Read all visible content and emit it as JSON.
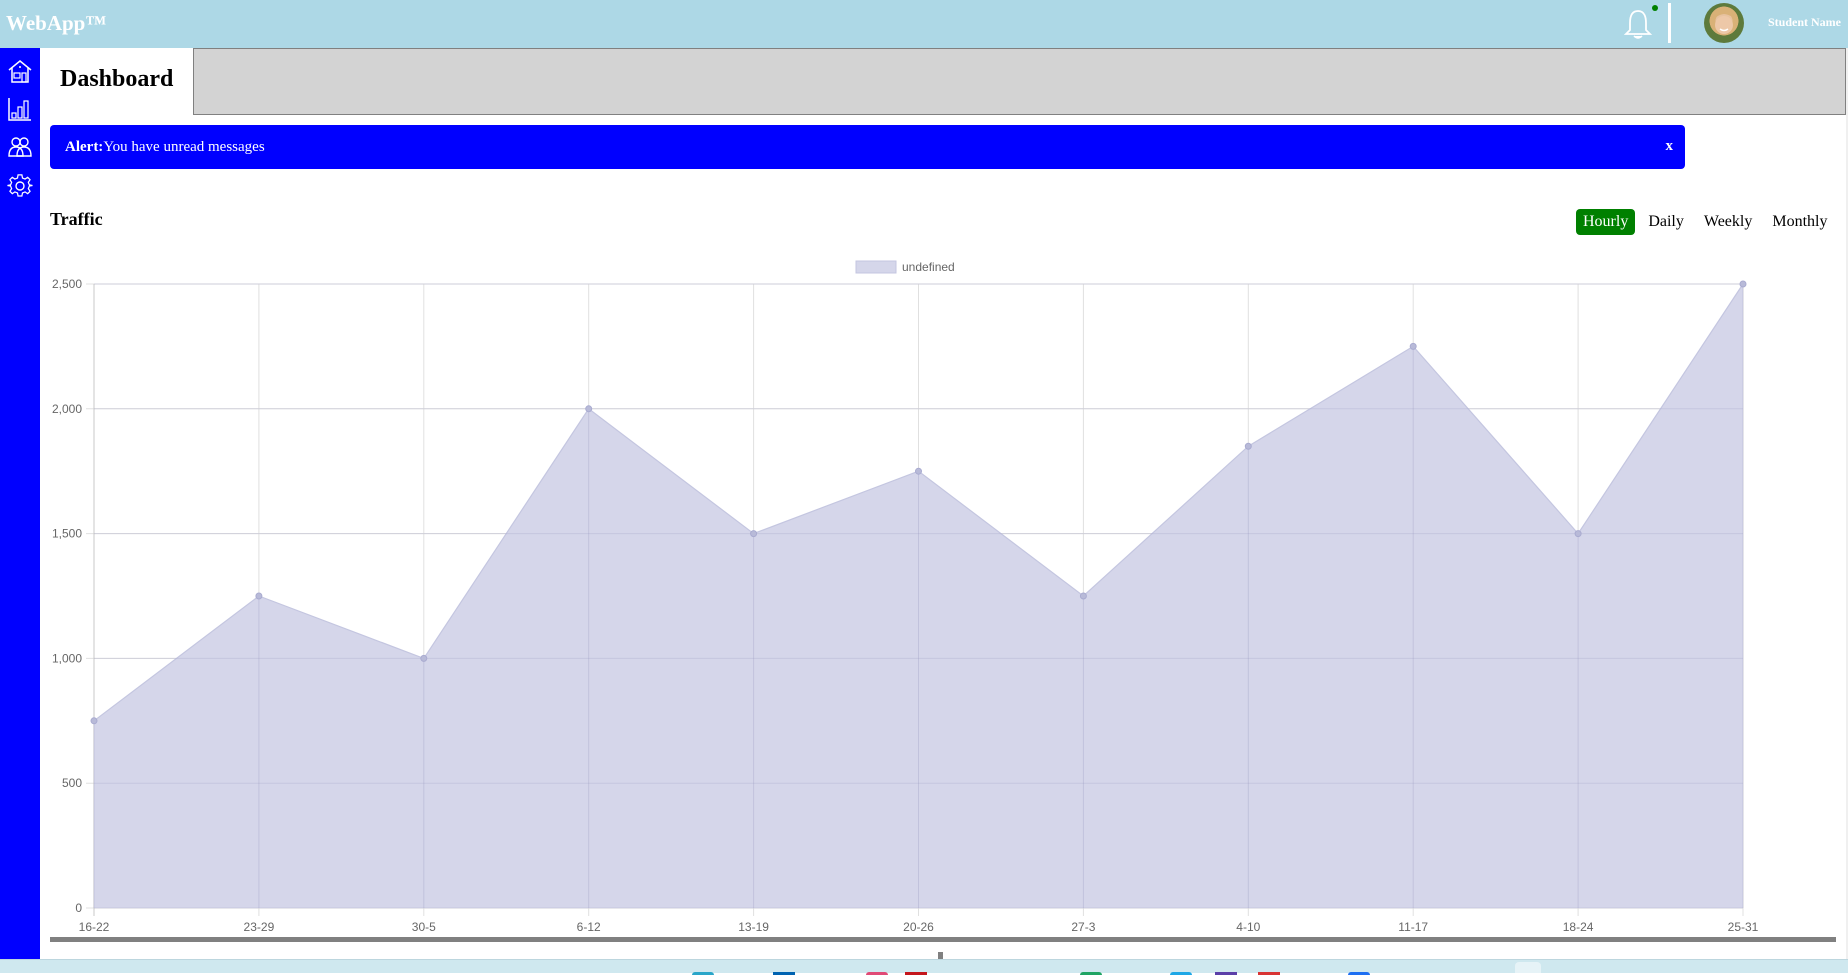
{
  "header": {
    "logo": "WebApp™",
    "user_name": "Student Name",
    "notification_dot_color": "#008000",
    "avatar_alt": "user-avatar"
  },
  "sidebar": {
    "items": [
      {
        "name": "home",
        "icon": "home-icon"
      },
      {
        "name": "analytics",
        "icon": "bar-chart-icon"
      },
      {
        "name": "users",
        "icon": "users-icon"
      },
      {
        "name": "settings",
        "icon": "gear-icon"
      }
    ]
  },
  "page": {
    "title": "Dashboard"
  },
  "alert": {
    "label": "Alert:",
    "message": "You have unread messages",
    "close": "x",
    "color": "#0000ff"
  },
  "traffic": {
    "title": "Traffic",
    "ranges": [
      {
        "label": "Hourly",
        "active": true
      },
      {
        "label": "Daily",
        "active": false
      },
      {
        "label": "Weekly",
        "active": false
      },
      {
        "label": "Monthly",
        "active": false
      }
    ],
    "active_color": "#008000"
  },
  "chart_data": {
    "type": "area",
    "title": "",
    "xlabel": "",
    "ylabel": "",
    "categories": [
      "16-22",
      "23-29",
      "30-5",
      "6-12",
      "13-19",
      "20-26",
      "27-3",
      "4-10",
      "11-17",
      "18-24",
      "25-31"
    ],
    "series": [
      {
        "name": "undefined",
        "values": [
          750,
          1250,
          1000,
          2000,
          1500,
          1750,
          1250,
          1850,
          2250,
          1500,
          2500
        ],
        "fill_color": "#d5d6ea",
        "line_color": "#c4c6e0",
        "point_color": "#b8bad8"
      }
    ],
    "ylim": [
      0,
      2500
    ],
    "yticks": [
      0,
      500,
      1000,
      1500,
      2000,
      2500
    ],
    "ytick_labels": [
      "0",
      "500",
      "1,000",
      "1,500",
      "2,000",
      "2,500"
    ],
    "grid": true,
    "legend": "top-center"
  }
}
